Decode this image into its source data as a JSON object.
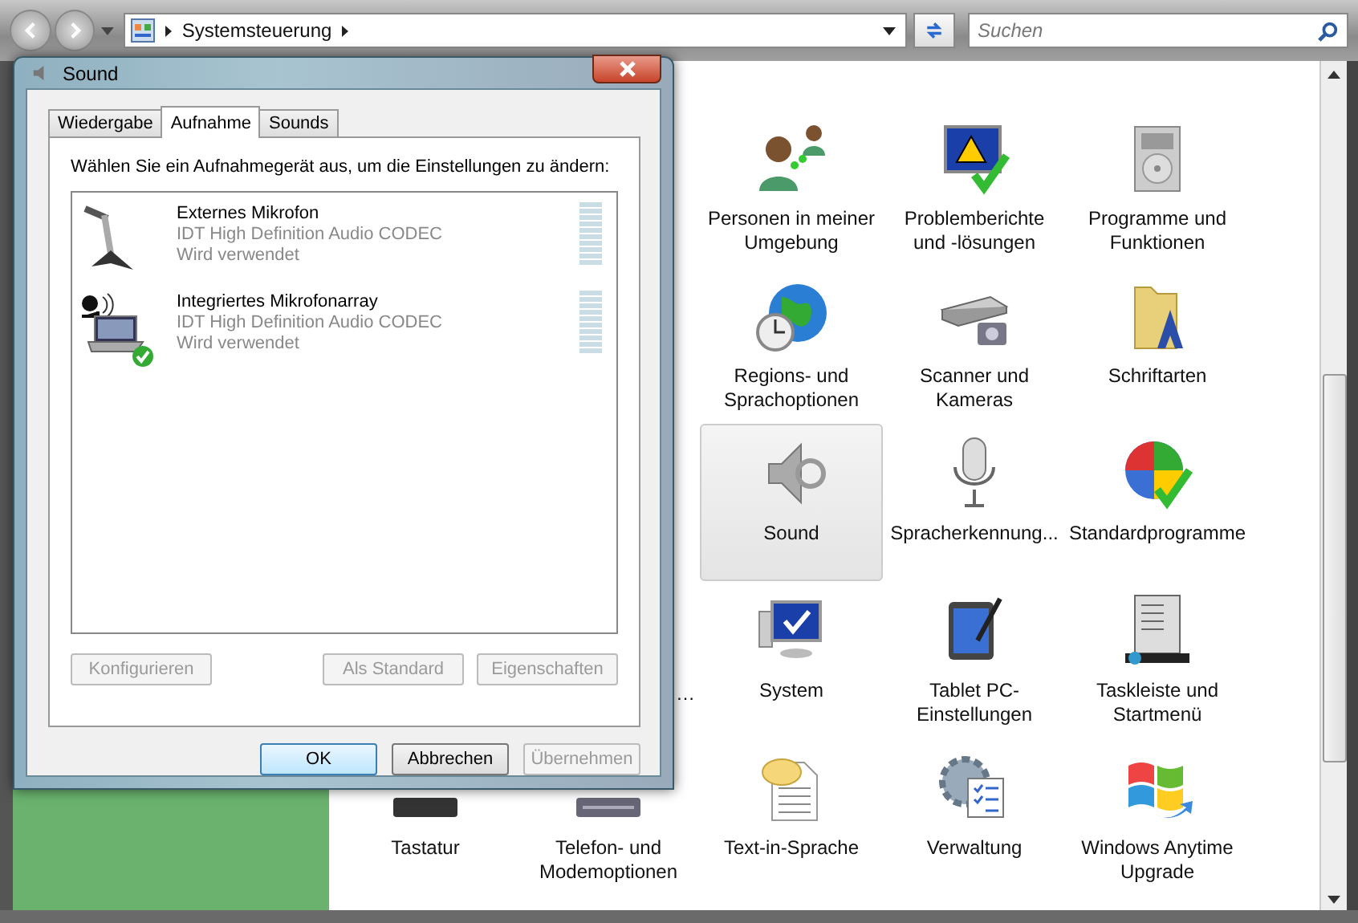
{
  "explorer": {
    "address": {
      "crumb": "Systemsteuerung"
    },
    "search": {
      "placeholder": "Suchen"
    }
  },
  "grid": {
    "rows": [
      [
        null,
        null,
        {
          "label": "Personen in meiner Umgebung",
          "selected": false
        },
        {
          "label": "Problemberichte und -lösungen",
          "selected": false
        },
        {
          "label": "Programme und Funktionen",
          "selected": false
        }
      ],
      [
        null,
        null,
        {
          "label": "Regions- und Sprachoptionen",
          "selected": false
        },
        {
          "label": "Scanner und Kameras",
          "selected": false
        },
        {
          "label": "Schriftarten",
          "selected": false
        }
      ],
      [
        null,
        null,
        {
          "label": "Sound",
          "selected": true
        },
        {
          "label": "Spracherkennung...",
          "selected": false
        },
        {
          "label": "Standardprogramme",
          "selected": false
        }
      ],
      [
        null,
        {
          "label": "…",
          "kind": "cut"
        },
        {
          "label": "System",
          "selected": false
        },
        {
          "label": "Tablet PC-Einstellungen",
          "selected": false
        },
        {
          "label": "Taskleiste und Startmenü",
          "selected": false
        }
      ],
      [
        {
          "label": "Tastatur",
          "selected": false
        },
        {
          "label": "Telefon- und Modemoptionen",
          "selected": false
        },
        {
          "label": "Text-in-Sprache",
          "selected": false
        },
        {
          "label": "Verwaltung",
          "selected": false
        },
        {
          "label": "Windows Anytime Upgrade",
          "selected": false
        }
      ]
    ]
  },
  "dialog": {
    "title": "Sound",
    "tabs": [
      {
        "label": "Wiedergabe",
        "selected": false
      },
      {
        "label": "Aufnahme",
        "selected": true
      },
      {
        "label": "Sounds",
        "selected": false
      }
    ],
    "instruction": "Wählen Sie ein Aufnahmegerät aus, um die Einstellungen zu ändern:",
    "devices": [
      {
        "name": "Externes Mikrofon",
        "driver": "IDT High Definition Audio CODEC",
        "status": "Wird verwendet",
        "default": false
      },
      {
        "name": "Integriertes Mikrofonarray",
        "driver": "IDT High Definition Audio CODEC",
        "status": "Wird verwendet",
        "default": true
      }
    ],
    "device_buttons": [
      {
        "label": "Konfigurieren",
        "disabled": true
      },
      {
        "label": "Als Standard",
        "disabled": true
      },
      {
        "label": "Eigenschaften",
        "disabled": true
      }
    ],
    "buttons": [
      {
        "label": "OK",
        "disabled": false,
        "default": true
      },
      {
        "label": "Abbrechen",
        "disabled": false,
        "default": false
      },
      {
        "label": "Übernehmen",
        "disabled": true,
        "default": false
      }
    ]
  }
}
